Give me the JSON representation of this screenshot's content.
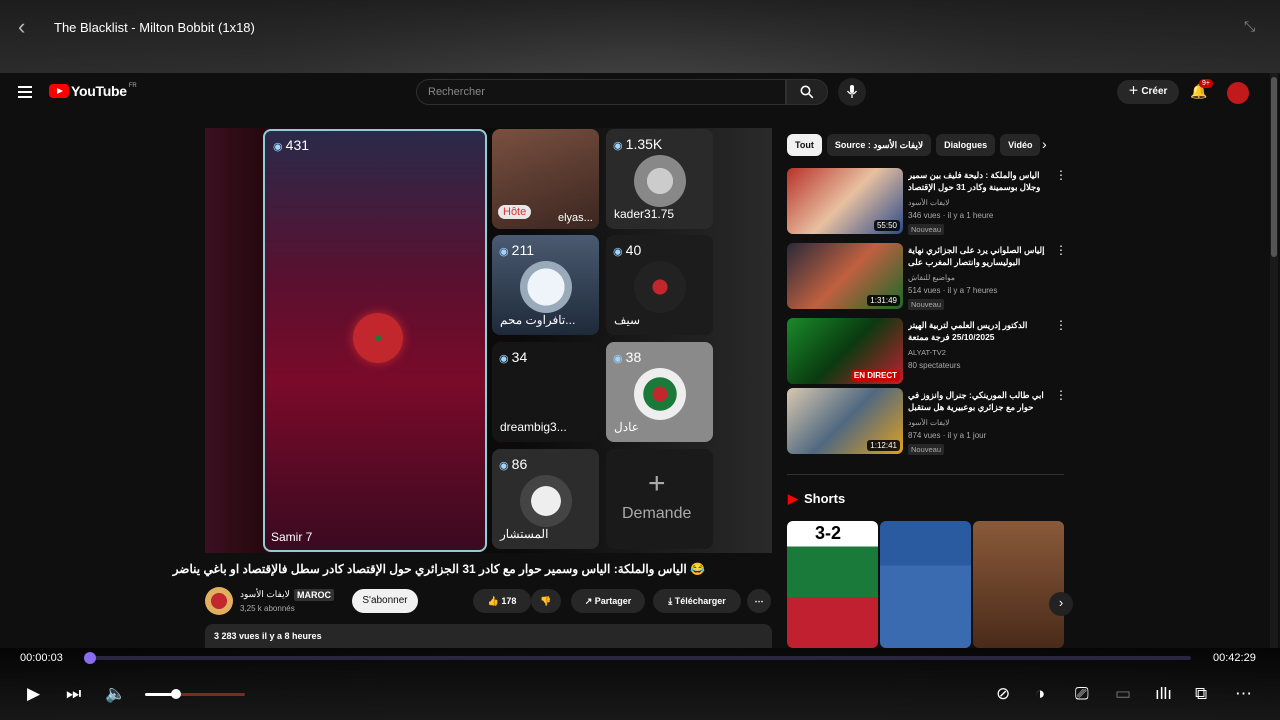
{
  "player": {
    "title": "The Blacklist - Milton Bobbit (1x18)",
    "time_current": "00:00:03",
    "time_total": "00:42:29",
    "progress_fraction": 0.001,
    "volume_fraction": 0.31
  },
  "header": {
    "logo_text": "YouTube",
    "country": "FR",
    "search_placeholder": "Rechercher",
    "create_label": "Créer",
    "notif_count": "9+"
  },
  "video": {
    "main": {
      "count": "431",
      "name": "Samir 7"
    },
    "tiles": [
      {
        "count": "",
        "name": "elyas...",
        "badge": "Hôte"
      },
      {
        "count": "1.35K",
        "name": "kader31.75"
      },
      {
        "count": "211",
        "name": "تافراوت محم..."
      },
      {
        "count": "40",
        "name": "سيف"
      },
      {
        "count": "34",
        "name": "dreambig3..."
      },
      {
        "count": "38",
        "name": "عادل"
      },
      {
        "count": "86",
        "name": "المستشار"
      },
      {
        "count": "",
        "name": "Demande"
      }
    ],
    "title": "😂 الياس والملكة: الياس وسمير حوار مع كادر 31 الجزائري حول الإقتصاد كادر سطل فالإقتصاد او باغي يناضر",
    "channel": "لايفات الأسود",
    "channel_tag": "MAROC",
    "subscribers": "3,25 k abonnés",
    "subscribe_label": "S'abonner",
    "likes": "178",
    "share_label": "Partager",
    "download_label": "Télécharger",
    "views_date": "3 283 vues  il y a 8 heures"
  },
  "sidebar": {
    "chips": [
      "Tout",
      "Source : لايفات الأسود",
      "Dialogues",
      "Vidéo"
    ],
    "recs": [
      {
        "title": "الياس والملكة : دليحة فليف بين سمير وجلال بوسمينة وكادر 31 حول الإقتصاد ...",
        "channel": "لايفات الأسود",
        "meta": "346 vues · il y a 1 heure",
        "badge": "Nouveau",
        "duration": "55:50"
      },
      {
        "title": "إلياس الصلواني يرد على الجزائري نهاية البوليساريو وانتصار المغرب على الكراطة",
        "channel": "مواضيع للنقاش",
        "meta": "514 vues · il y a 7 heures",
        "badge": "Nouveau",
        "duration": "1:31:49"
      },
      {
        "title": "الدكتور إدريس العلمي لتربية الهيتر 25/10/2025 فرجة ممتعة",
        "channel": "ALYAT-TV2",
        "meta": "80 spectateurs",
        "badge": "",
        "duration": "EN DIRECT"
      },
      {
        "title": "ابي طالب المورينكي: جنرال وانزوز في حوار مع جزائري بوعبيرية هل ستقبل الجزائر",
        "channel": "لايفات الأسود",
        "meta": "874 vues · il y a 1 jour",
        "badge": "Nouveau",
        "duration": "1:12:41"
      }
    ],
    "shorts_title": "Shorts",
    "shorts_score": "3-2"
  },
  "colors": {
    "accent": "#8a6cf0",
    "yt_red": "#ff0000"
  }
}
